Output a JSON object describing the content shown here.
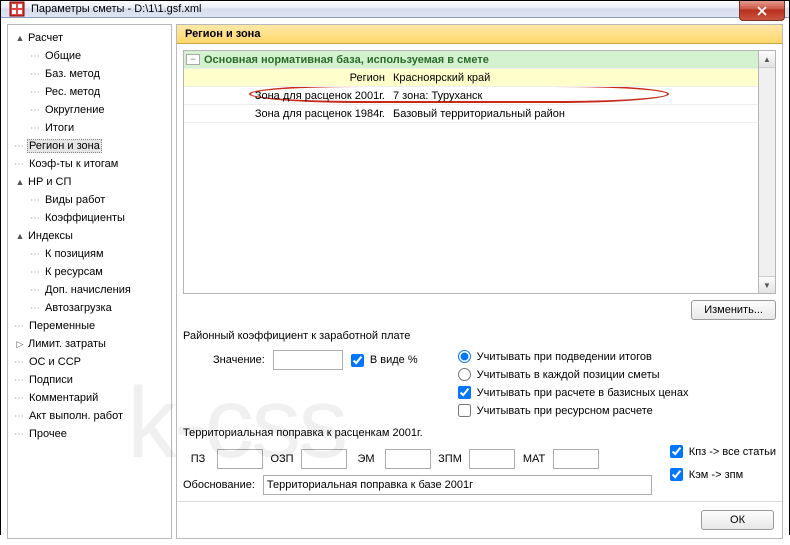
{
  "window": {
    "title": "Параметры сметы - D:\\1\\1.gsf.xml"
  },
  "tree": [
    {
      "exp": "▲",
      "lbl": "Расчет",
      "lvl": 0
    },
    {
      "dots": true,
      "lbl": "Общие",
      "lvl": 1
    },
    {
      "dots": true,
      "lbl": "Баз. метод",
      "lvl": 1
    },
    {
      "dots": true,
      "lbl": "Рес. метод",
      "lvl": 1
    },
    {
      "dots": true,
      "lbl": "Округление",
      "lvl": 1
    },
    {
      "dots": true,
      "lbl": "Итоги",
      "lvl": 1
    },
    {
      "dots": true,
      "lbl": "Регион и зона",
      "lvl": 0,
      "selected": true
    },
    {
      "dots": true,
      "lbl": "Коэф-ты к итогам",
      "lvl": 0
    },
    {
      "exp": "▲",
      "lbl": "НР и СП",
      "lvl": 0
    },
    {
      "dots": true,
      "lbl": "Виды работ",
      "lvl": 1
    },
    {
      "dots": true,
      "lbl": "Коэффициенты",
      "lvl": 1
    },
    {
      "exp": "▲",
      "lbl": "Индексы",
      "lvl": 0
    },
    {
      "dots": true,
      "lbl": "К позициям",
      "lvl": 1
    },
    {
      "dots": true,
      "lbl": "К ресурсам",
      "lvl": 1
    },
    {
      "dots": true,
      "lbl": "Доп. начисления",
      "lvl": 1
    },
    {
      "dots": true,
      "lbl": "Автозагрузка",
      "lvl": 1
    },
    {
      "dots": true,
      "lbl": "Переменные",
      "lvl": 0
    },
    {
      "exp": "▷",
      "lbl": "Лимит. затраты",
      "lvl": 0
    },
    {
      "dots": true,
      "lbl": "ОС и ССР",
      "lvl": 0
    },
    {
      "dots": true,
      "lbl": "Подписи",
      "lvl": 0
    },
    {
      "dots": true,
      "lbl": "Комментарий",
      "lvl": 0
    },
    {
      "dots": true,
      "lbl": "Акт выполн. работ",
      "lvl": 0
    },
    {
      "dots": true,
      "lbl": "Прочее",
      "lvl": 0
    }
  ],
  "panel": {
    "header": "Регион и зона",
    "grid": {
      "group_header": "Основная нормативная база, используемая в смете",
      "rows": [
        {
          "c1": "Регион",
          "c2": "Красноярский край",
          "hl": true
        },
        {
          "c1": "Зона для расценок 2001г.",
          "c2": "7 зона: Туруханск"
        },
        {
          "c1": "Зона для расценок 1984г.",
          "c2": "Базовый территориальный район"
        }
      ]
    },
    "change_btn": "Изменить...",
    "section1": "Районный коэффициент к заработной плате",
    "value_label": "Значение:",
    "in_percent": "В виде %",
    "radios": [
      {
        "label": "Учитывать при подведении итогов",
        "checked": true
      },
      {
        "label": "Учитывать в каждой позиции сметы",
        "checked": false
      }
    ],
    "checks": [
      {
        "label": "Учитывать при расчете в базисных ценах",
        "checked": true
      },
      {
        "label": "Учитывать при ресурсном расчете",
        "checked": false
      }
    ],
    "section2": "Территориальная поправка к расценкам 2001г.",
    "coefs": [
      "ПЗ",
      "ОЗП",
      "ЭМ",
      "ЗПМ",
      "МАТ"
    ],
    "side_checks": [
      {
        "label": "Кпз -> все статьи",
        "checked": true
      },
      {
        "label": "Кэм -> зпм",
        "checked": true
      }
    ],
    "obos_label": "Обоснование:",
    "obos_value": "Территориальная поправка к базе 2001г"
  },
  "footer": {
    "ok": "ОК"
  },
  "watermark": "k-css"
}
